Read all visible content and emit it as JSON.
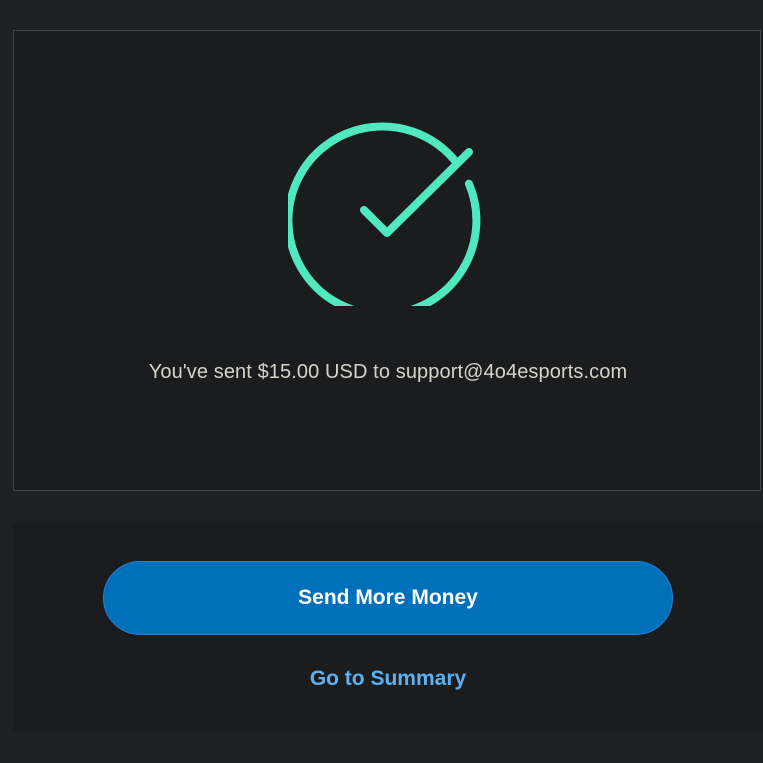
{
  "success": {
    "icon": "check-circle-icon",
    "icon_color": "#4fe8bf",
    "message": "You've sent $15.00 USD to support@4o4esports.com"
  },
  "actions": {
    "send_more_label": "Send More Money",
    "send_more_color": "#0070ba",
    "summary_label": "Go to Summary",
    "summary_color": "#5ab2f5"
  }
}
